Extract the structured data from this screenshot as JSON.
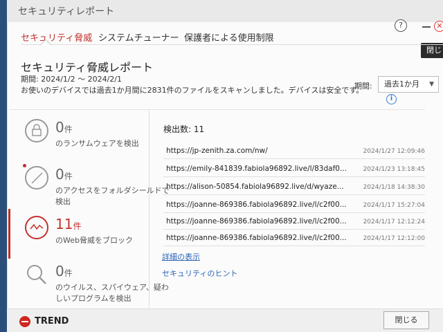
{
  "window": {
    "title": "セキュリティレポート"
  },
  "header": {
    "tooltip": "閉じ"
  },
  "tabs": [
    {
      "label": "セキュリティ脅威",
      "active": true
    },
    {
      "label": "システムチューナー",
      "active": false
    },
    {
      "label": "保護者による使用制限",
      "active": false
    }
  ],
  "report": {
    "title": "セキュリティ脅威レポート",
    "period_text": "期間: 2024/1/2 ～ 2024/2/1",
    "scan_message": "お使いのデバイスでは過去1か月間に2831件のファイルをスキャンしました。デバイスは安全です。",
    "period_label": "期間:",
    "period_select_value": "過去1か月"
  },
  "stats": [
    {
      "count": "0",
      "unit": "件",
      "desc": "のランサムウェアを検出",
      "icon": "lock-icon"
    },
    {
      "count": "0",
      "unit": "件",
      "desc": "のアクセスをフォルダシールドで検出",
      "icon": "block-icon"
    },
    {
      "count": "11",
      "unit": "件",
      "desc": "のWeb脅威をブロック",
      "icon": "web-threat-icon"
    },
    {
      "count": "0",
      "unit": "件",
      "desc": "のウイルス、スパイウェア、疑わしいプログラムを検出",
      "icon": "magnifier-icon"
    }
  ],
  "detections": {
    "title": "検出数: 11",
    "rows": [
      {
        "url": "https://jp-zenith.za.com/nw/",
        "time": "2024/1/27 12:09:46"
      },
      {
        "url": "https://emily-841839.fabiola96892.live/l/83daf0...",
        "time": "2024/1/23 13:18:45"
      },
      {
        "url": "https://alison-50854.fabiola96892.live/d/wyaze...",
        "time": "2024/1/18 14:38:30"
      },
      {
        "url": "https://joanne-869386.fabiola96892.live/l/c2f00...",
        "time": "2024/1/17 15:27:04"
      },
      {
        "url": "https://joanne-869386.fabiola96892.live/l/c2f00...",
        "time": "2024/1/17 12:12:24"
      },
      {
        "url": "https://joanne-869386.fabiola96892.live/l/c2f00...",
        "time": "2024/1/17 12:12:00"
      }
    ],
    "details_link": "詳細の表示",
    "hint_link": "セキュリティのヒント"
  },
  "footer": {
    "brand": "TREND",
    "close_label": "閉じる"
  },
  "colors": {
    "accent": "#c0312c",
    "link": "#2b65b7"
  }
}
